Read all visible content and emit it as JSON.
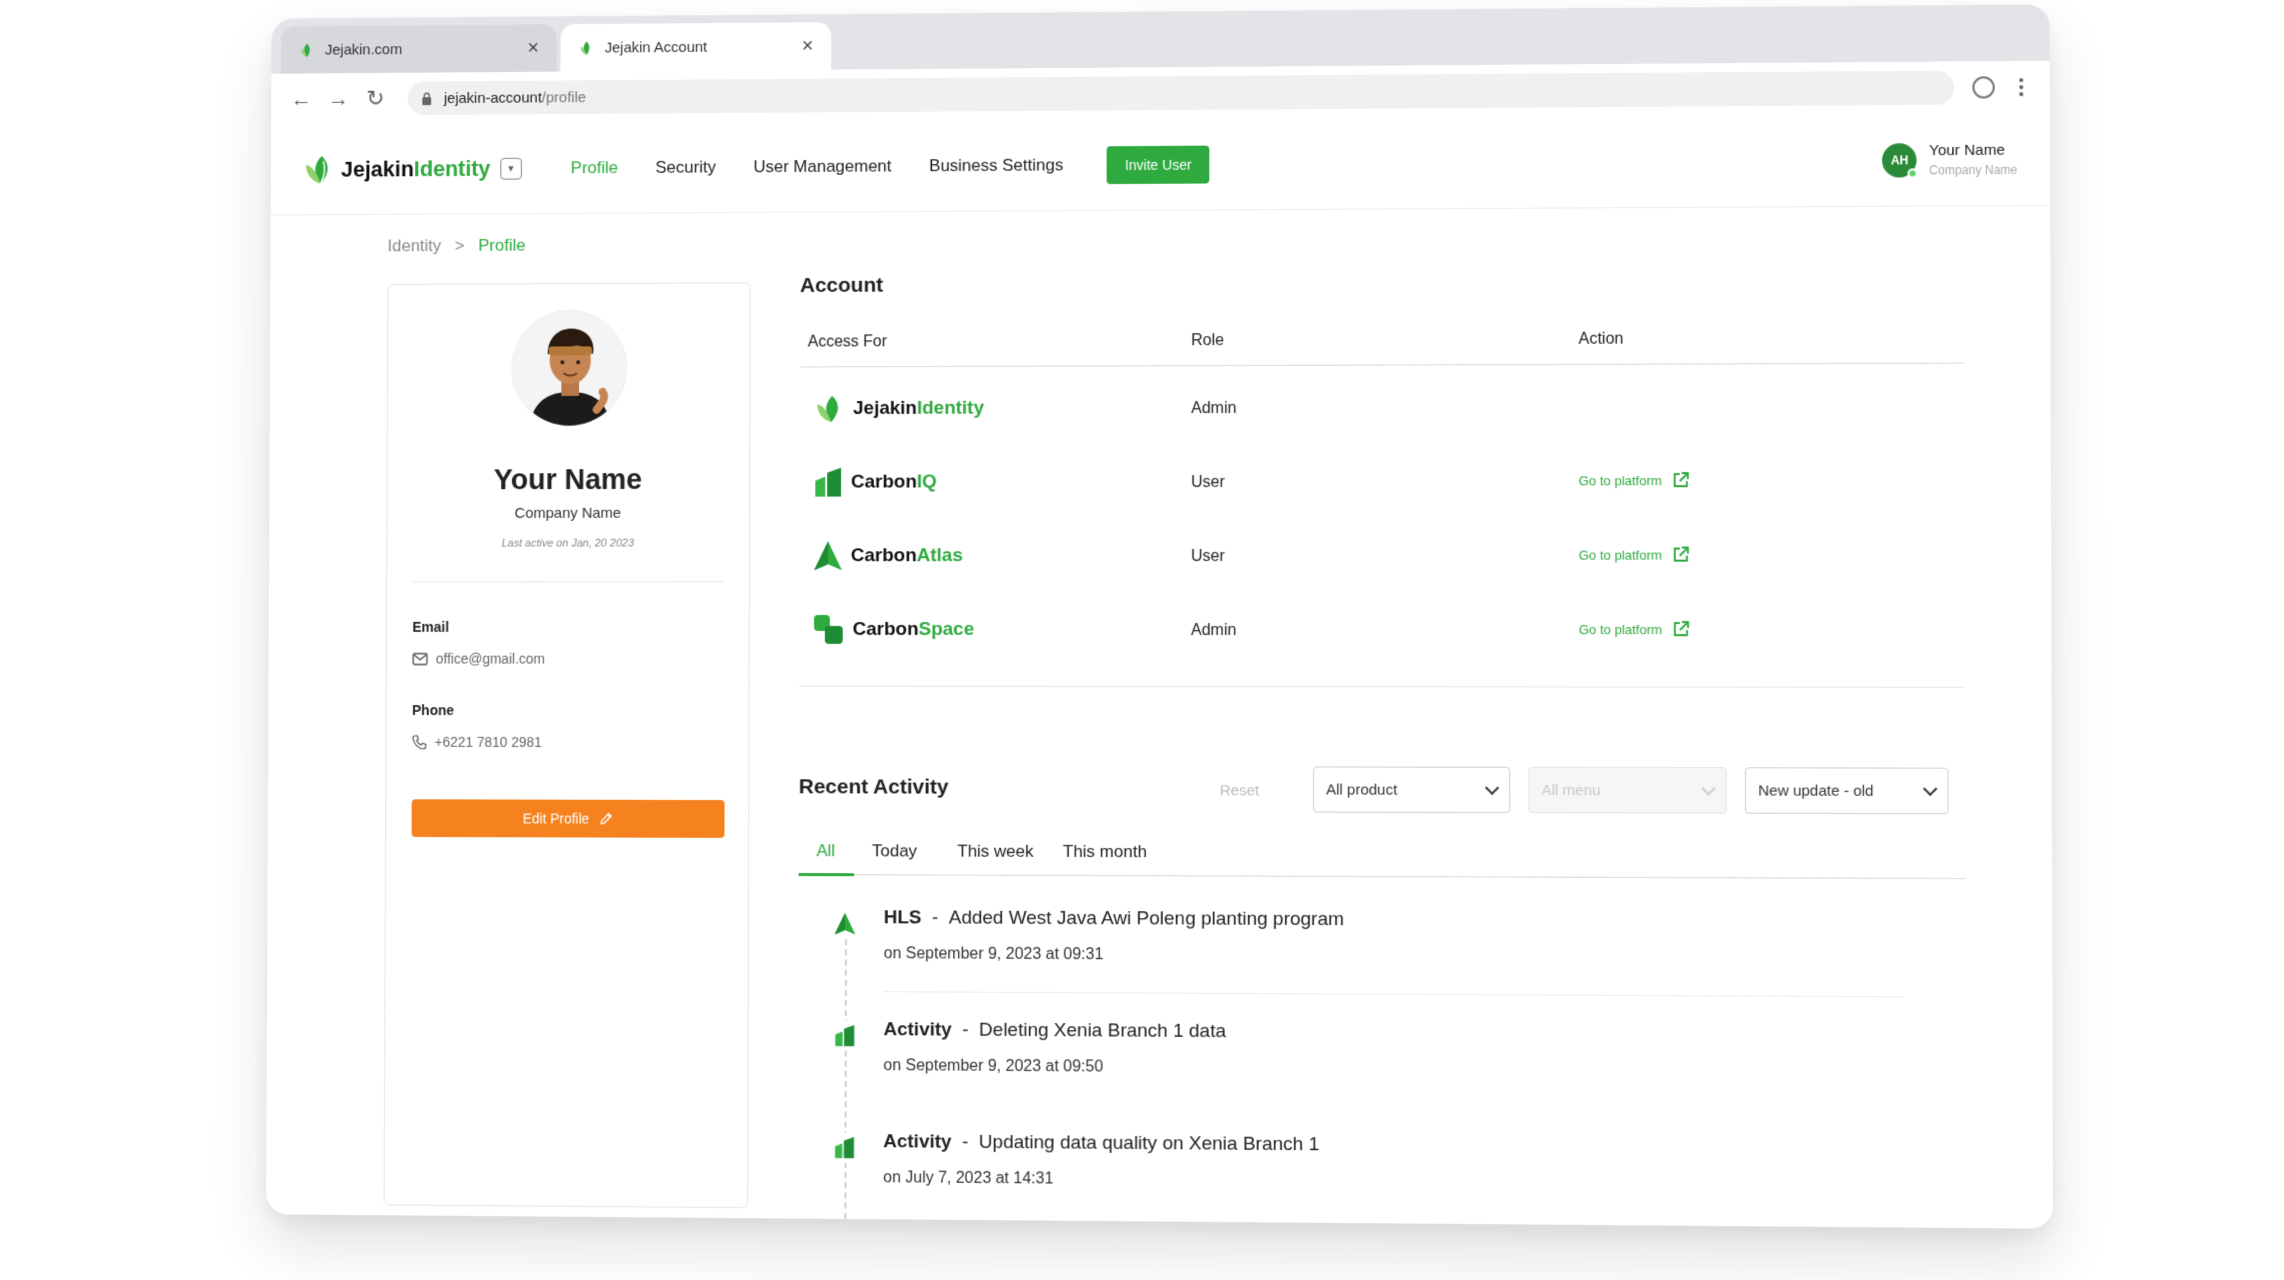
{
  "browser": {
    "tabs": [
      {
        "title": "Jejakin.com",
        "active": false
      },
      {
        "title": "Jejakin Account",
        "active": true
      }
    ],
    "url_host": "jejakin-account",
    "url_path": "/profile"
  },
  "header": {
    "logo_main": "Jejakin",
    "logo_accent": "Identity",
    "nav": [
      {
        "label": "Profile",
        "current": true
      },
      {
        "label": "Security",
        "current": false
      },
      {
        "label": "User Management",
        "current": false
      },
      {
        "label": "Business Settings",
        "current": false
      }
    ],
    "invite_label": "Invite User",
    "user_initials": "AH",
    "user_name": "Your Name",
    "user_company": "Company Name"
  },
  "breadcrumb": {
    "root": "Identity",
    "separator": ">",
    "current": "Profile"
  },
  "profile": {
    "name": "Your Name",
    "company": "Company Name",
    "last_active": "Last active on Jan, 20 2023",
    "email_label": "Email",
    "email": "office@gmail.com",
    "phone_label": "Phone",
    "phone": "+6221 7810 2981",
    "edit_label": "Edit Profile"
  },
  "account": {
    "title": "Account",
    "columns": {
      "access": "Access For",
      "role": "Role",
      "action": "Action"
    },
    "rows": [
      {
        "brand_main": "Jejakin",
        "brand_accent": "Identity",
        "icon": "jejakin-leaf-icon",
        "role": "Admin",
        "action": ""
      },
      {
        "brand_main": "Carbon",
        "brand_accent": "IQ",
        "icon": "carboniq-bars-icon",
        "role": "User",
        "action": "Go to platform"
      },
      {
        "brand_main": "Carbon",
        "brand_accent": "Atlas",
        "icon": "carbonatlas-tree-icon",
        "role": "User",
        "action": "Go to platform"
      },
      {
        "brand_main": "Carbon",
        "brand_accent": "Space",
        "icon": "carbonspace-blocks-icon",
        "role": "Admin",
        "action": "Go to platform"
      }
    ]
  },
  "activity": {
    "title": "Recent Activity",
    "reset": "Reset",
    "filters": {
      "product": "All product",
      "menu": "All menu",
      "sort": "New update - old"
    },
    "tabs": [
      "All",
      "Today",
      "This week",
      "This month"
    ],
    "active_tab": "All",
    "items": [
      {
        "tag": "HLS",
        "dash": "-",
        "text": "Added West Java Awi Poleng planting program",
        "time": "on September 9, 2023 at 09:31",
        "icon": "carbonatlas-tree-icon"
      },
      {
        "tag": "Activity",
        "dash": "-",
        "text": "Deleting Xenia Branch 1 data",
        "time": "on September 9, 2023 at 09:50",
        "icon": "carboniq-bars-icon"
      },
      {
        "tag": "Activity",
        "dash": "-",
        "text": "Updating data quality on Xenia Branch 1",
        "time": "on July 7, 2023 at 14:31",
        "icon": "carboniq-bars-icon"
      }
    ]
  },
  "colors": {
    "brand_green": "#2faa3e",
    "edit_orange": "#f5821f"
  }
}
